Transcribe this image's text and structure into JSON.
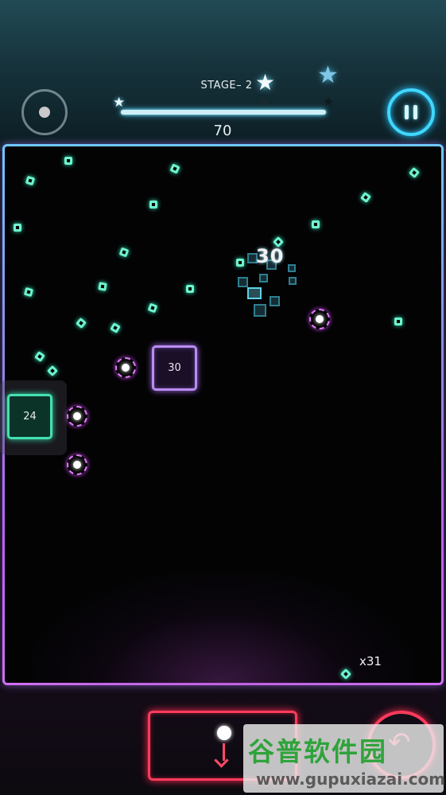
{
  "header": {
    "stage_label": "STAGE– 2",
    "score": "70",
    "stage_progress": 1.0,
    "stars": [
      {
        "name": "star-1",
        "state": "earned"
      },
      {
        "name": "star-2",
        "state": "earned"
      },
      {
        "name": "star-3",
        "state": "earned"
      }
    ]
  },
  "board": {
    "bricks": [
      {
        "id": "brick-30",
        "hits": "30",
        "color": "#b88df0"
      },
      {
        "id": "brick-24",
        "hits": "24",
        "color": "#45e0b0"
      }
    ],
    "hit_popup": "30",
    "ball_count": "x31"
  },
  "controls": {
    "ball_skin_icon": "ball-icon",
    "pause_icon": "pause-icon",
    "drop_icon": "drop-down-icon",
    "undo_icon": "undo-icon"
  },
  "watermark": {
    "chinese": "谷普软件园",
    "latin": "www.gupuxiazai.com"
  },
  "colors": {
    "accent_cyan": "#3fd8ff",
    "gem_green": "#6ff5d0",
    "button_red": "#ff3b5c",
    "ring_pink": "#e07df7"
  }
}
